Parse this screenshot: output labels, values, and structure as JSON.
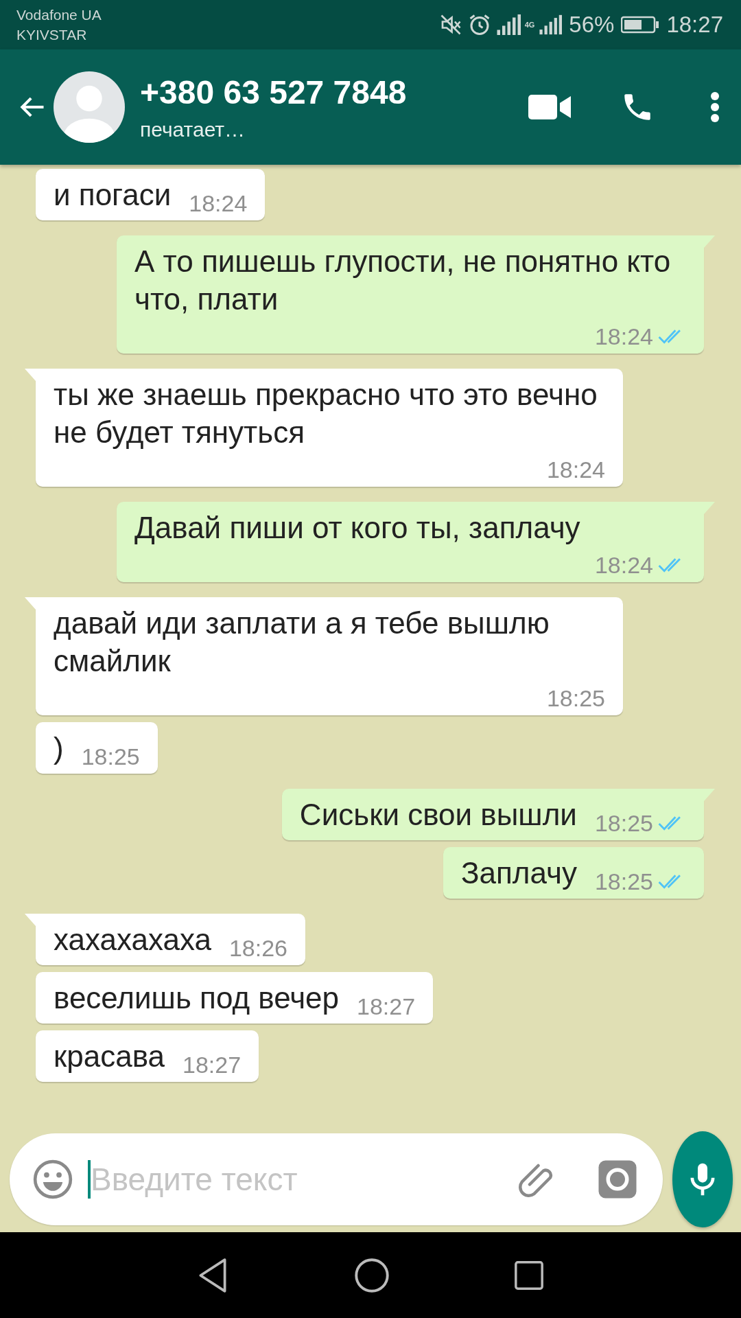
{
  "status_bar": {
    "carriers": [
      "Vodafone UA",
      "KYIVSTAR"
    ],
    "network_type": "4G",
    "battery": "56%",
    "time": "18:27"
  },
  "header": {
    "contact": "+380 63 527 7848",
    "status": "печатает…"
  },
  "messages": [
    {
      "kind": "in",
      "tail": false,
      "text": "и погаси",
      "time": "18:24"
    },
    {
      "kind": "out",
      "tail": true,
      "text": "А то пишешь глупости, не понятно кто что, плати",
      "time": "18:24",
      "read": true
    },
    {
      "kind": "in",
      "tail": true,
      "text": "ты же знаешь прекрасно что это вечно не будет тянуться",
      "time": "18:24"
    },
    {
      "kind": "out",
      "tail": true,
      "text": "Давай пиши от кого ты, заплачу",
      "time": "18:24",
      "read": true
    },
    {
      "kind": "in",
      "tail": true,
      "text": "давай иди заплати а я тебе вышлю смайлик",
      "time": "18:25"
    },
    {
      "kind": "in",
      "tail": false,
      "text": ")",
      "time": "18:25"
    },
    {
      "kind": "out",
      "tail": true,
      "text": "Сиськи свои вышли",
      "time": "18:25",
      "read": true
    },
    {
      "kind": "out",
      "tail": false,
      "text": "Заплачу",
      "time": "18:25",
      "read": true
    },
    {
      "kind": "in",
      "tail": true,
      "text": "хахахахаха",
      "time": "18:26"
    },
    {
      "kind": "in",
      "tail": false,
      "text": "веселишь под вечер",
      "time": "18:27"
    },
    {
      "kind": "in",
      "tail": false,
      "text": "красава",
      "time": "18:27"
    }
  ],
  "composer": {
    "placeholder": "Введите текст"
  }
}
